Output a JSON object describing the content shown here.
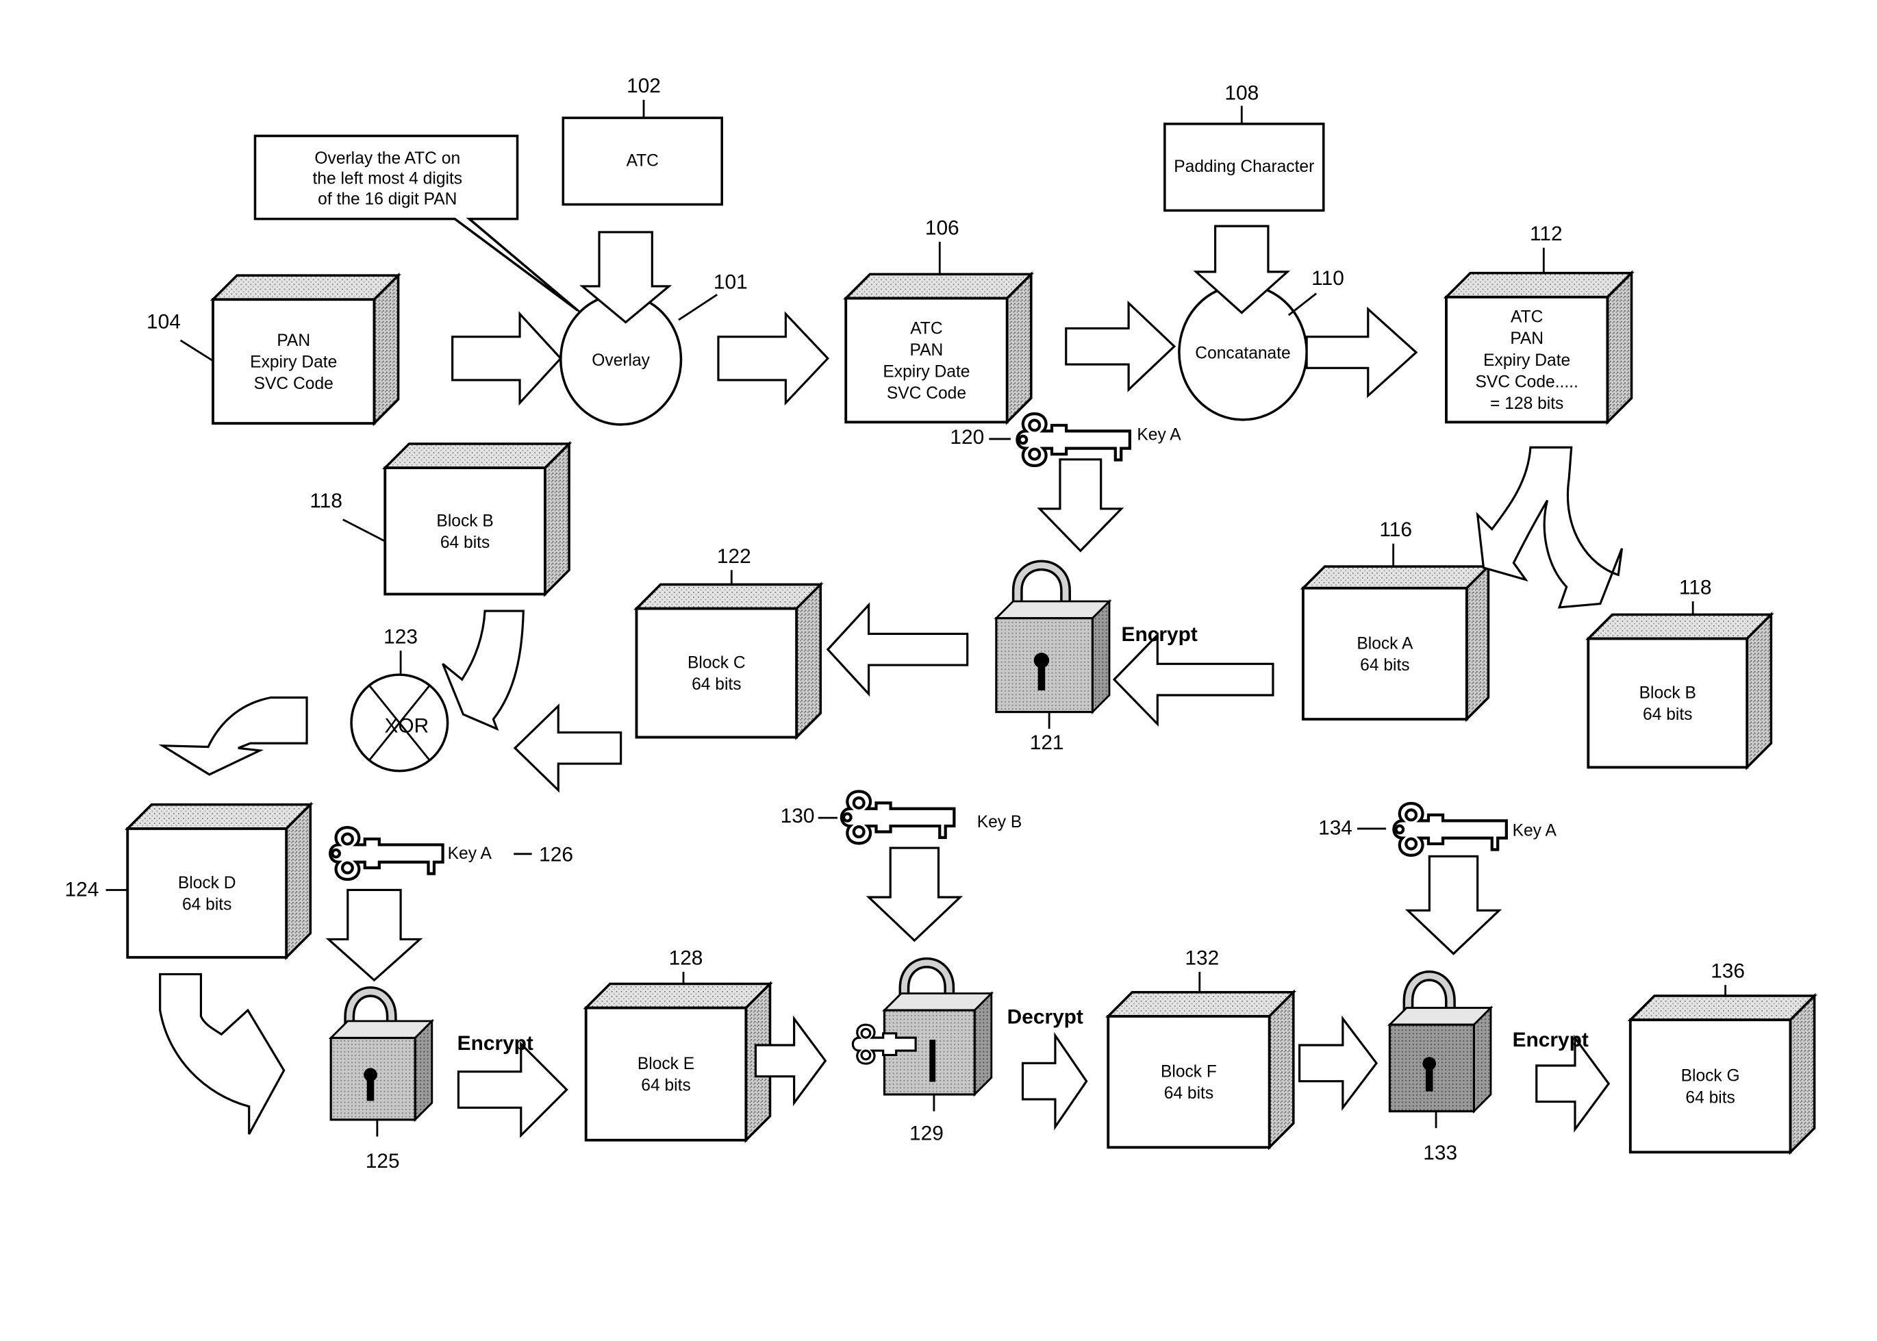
{
  "figure": {
    "title": "ATC overlay, concatenation and block encryption flow"
  },
  "callout": {
    "ref": "",
    "lines": [
      "Overlay the ATC on",
      "the left most 4 digits",
      "of the 16 digit PAN"
    ]
  },
  "inputs": {
    "atc": {
      "ref": "102",
      "label": "ATC"
    },
    "padding": {
      "ref": "108",
      "label": "Padding Character"
    }
  },
  "operations": {
    "overlay": {
      "ref": "101",
      "label": "Overlay"
    },
    "concatenate": {
      "ref": "110",
      "label": "Concatanate"
    },
    "xor": {
      "ref": "123",
      "label": "XOR"
    }
  },
  "blocks": {
    "b104": {
      "ref": "104",
      "lines": [
        "PAN",
        "Expiry Date",
        "SVC Code"
      ]
    },
    "b106": {
      "ref": "106",
      "lines": [
        "ATC",
        "PAN",
        "Expiry Date",
        "SVC Code"
      ]
    },
    "b112": {
      "ref": "112",
      "lines": [
        "ATC",
        "PAN",
        "Expiry Date",
        "SVC Code.....",
        "= 128 bits"
      ]
    },
    "b116": {
      "ref": "116",
      "lines": [
        "Block A",
        "64 bits"
      ]
    },
    "b118r": {
      "ref": "118",
      "lines": [
        "Block B",
        "64 bits"
      ]
    },
    "b118l": {
      "ref": "118",
      "lines": [
        "Block B",
        "64 bits"
      ]
    },
    "b122": {
      "ref": "122",
      "lines": [
        "Block C",
        "64 bits"
      ]
    },
    "b124": {
      "ref": "124",
      "lines": [
        "Block D",
        "64 bits"
      ]
    },
    "b128": {
      "ref": "128",
      "lines": [
        "Block E",
        "64 bits"
      ]
    },
    "b132": {
      "ref": "132",
      "lines": [
        "Block F",
        "64 bits"
      ]
    },
    "b136": {
      "ref": "136",
      "lines": [
        "Block G",
        "64 bits"
      ]
    }
  },
  "keys": {
    "k120": {
      "ref": "120",
      "label": "Key A"
    },
    "k126": {
      "ref": "126",
      "label": "Key A"
    },
    "k130": {
      "ref": "130",
      "label": "Key B"
    },
    "k134": {
      "ref": "134",
      "label": "Key A"
    }
  },
  "locks": {
    "l121": {
      "ref": "121",
      "action": "Encrypt"
    },
    "l125": {
      "ref": "125",
      "action": "Encrypt"
    },
    "l129": {
      "ref": "129",
      "action": "Decrypt"
    },
    "l133": {
      "ref": "133",
      "action": "Encrypt"
    }
  }
}
